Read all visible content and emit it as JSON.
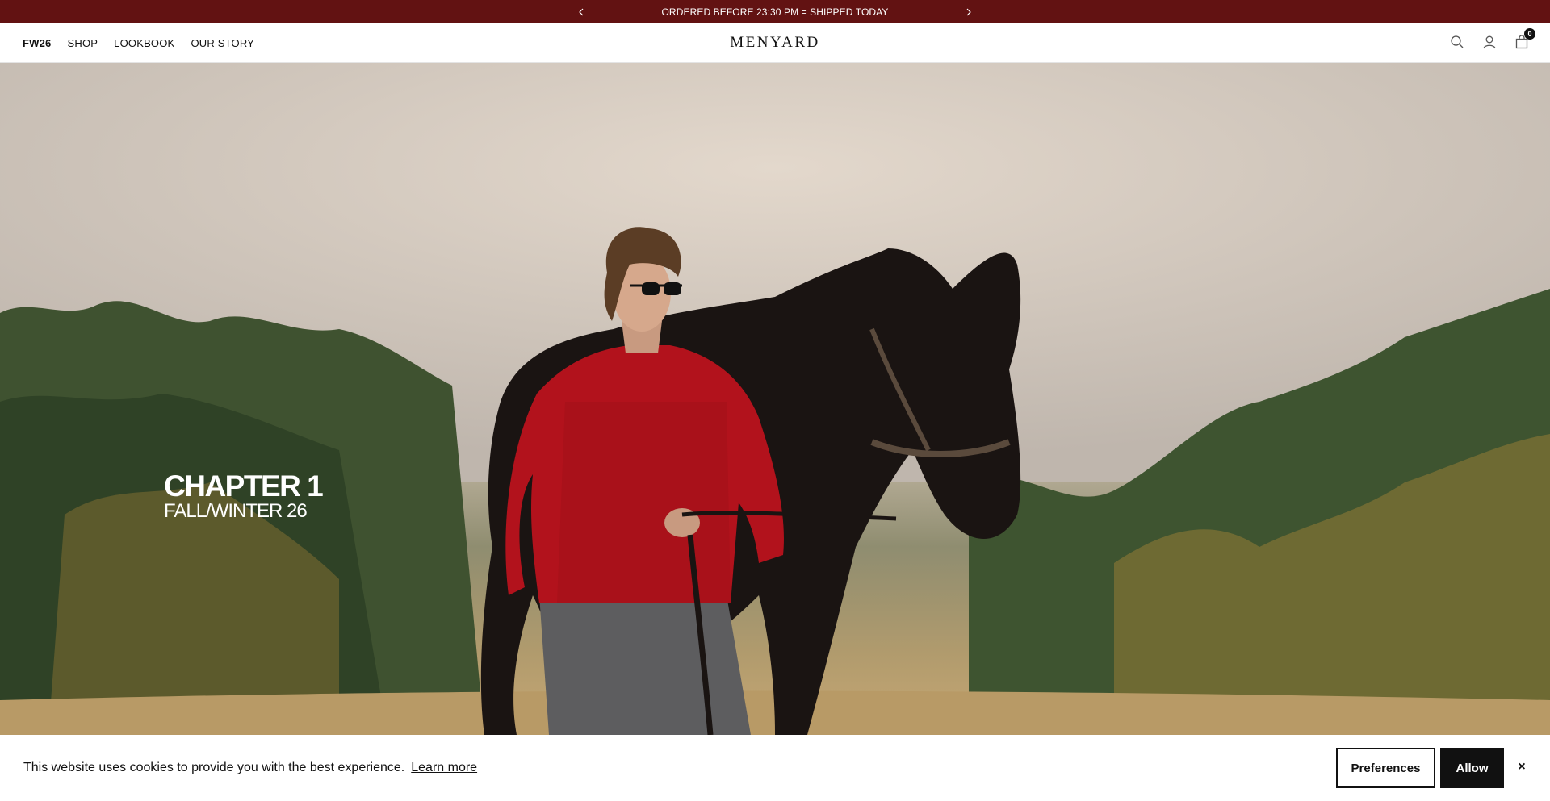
{
  "announcement": {
    "message": "ORDERED BEFORE 23:30 PM = SHIPPED TODAY",
    "background": "#621212"
  },
  "header": {
    "logo": "MENYARD",
    "nav": [
      {
        "label": "FW26"
      },
      {
        "label": "SHOP"
      },
      {
        "label": "LOOKBOOK"
      },
      {
        "label": "OUR STORY"
      }
    ],
    "icons": [
      "search-icon",
      "account-icon",
      "cart-icon"
    ],
    "cart_count": "0"
  },
  "hero": {
    "title": "CHAPTER 1",
    "subtitle": "FALL/WINTER 26"
  },
  "cookie": {
    "message": "This website uses cookies to provide you with the best experience.",
    "learn_more": "Learn more",
    "preferences": "Preferences",
    "allow": "Allow",
    "close": "×"
  }
}
